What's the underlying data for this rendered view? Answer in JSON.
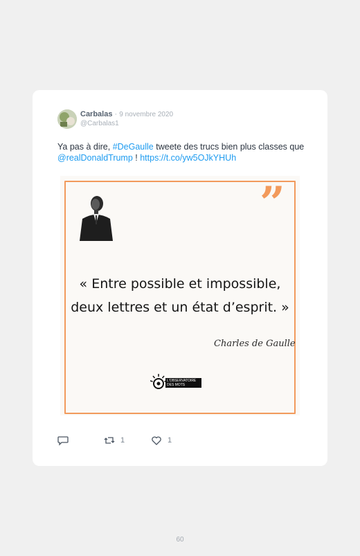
{
  "tweet": {
    "name": "Carbalas",
    "separator": "·",
    "date": "9 novembre 2020",
    "handle": "@Carbalas1",
    "text_part1": "Ya pas à dire, ",
    "hashtag": "#DeGaulle",
    "text_part2": " tweete des trucs bien plus classes que ",
    "mention": "@realDonaldTrump",
    "text_part3": " ! ",
    "link": "https://t.co/yw5OJkYHUh"
  },
  "quote_image": {
    "quote_line1": "« Entre possible et impossible,",
    "quote_line2": "deux lettres et un état d’esprit. »",
    "author": "Charles de Gaulle",
    "quote_mark": "”",
    "logo_line1": "L'OBSERVATOIRE",
    "logo_line2": "DES MOTS"
  },
  "actions": {
    "reply_icon": "reply-icon",
    "retweet_icon": "retweet-icon",
    "retweet_count": "1",
    "like_icon": "heart-icon",
    "like_count": "1"
  },
  "footer": {
    "page_number": "60"
  },
  "colors": {
    "link": "#1d9bf0",
    "accent_orange": "#f29a5c",
    "background": "#f0f0f0"
  }
}
